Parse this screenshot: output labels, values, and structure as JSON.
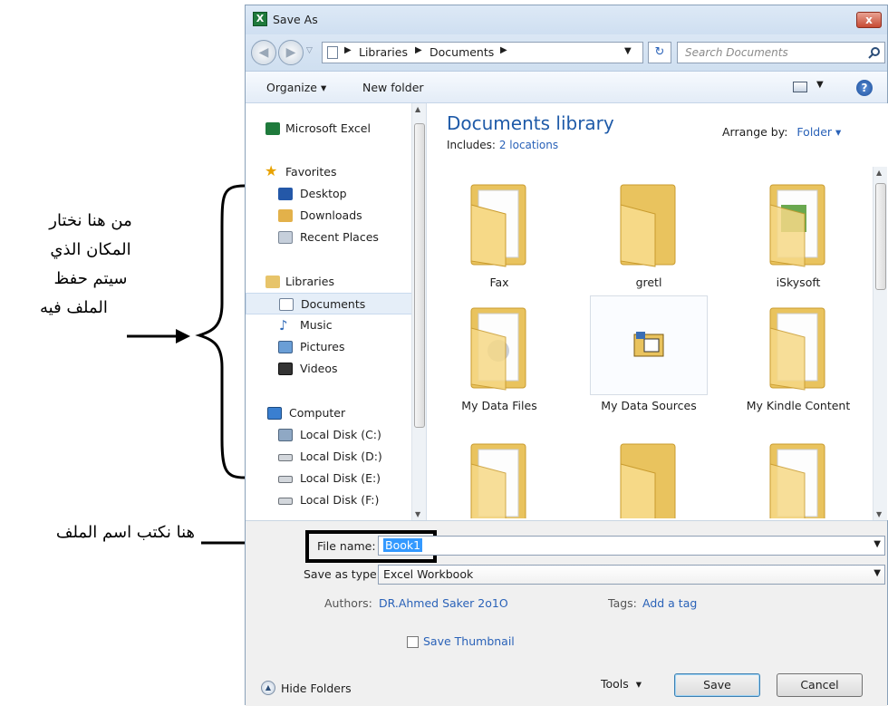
{
  "annotations": {
    "location_lines": [
      "من هنا نختار",
      "المكان الذي",
      "سيتم حفظ",
      "الملف فيه"
    ],
    "filename_note": "هنا نكتب اسم الملف"
  },
  "dialog": {
    "title": "Save As",
    "close_label": "x",
    "breadcrumb": [
      "Libraries",
      "Documents"
    ],
    "search_placeholder": "Search Documents",
    "toolbar": {
      "organize": "Organize",
      "new_folder": "New folder"
    },
    "nav": {
      "app": "Microsoft Excel",
      "favorites": "Favorites",
      "favorites_items": [
        "Desktop",
        "Downloads",
        "Recent Places"
      ],
      "libraries": "Libraries",
      "libraries_items": [
        "Documents",
        "Music",
        "Pictures",
        "Videos"
      ],
      "computer": "Computer",
      "computer_items": [
        "Local Disk (C:)",
        "Local Disk (D:)",
        "Local Disk (E:)",
        "Local Disk (F:)"
      ]
    },
    "library": {
      "title": "Documents library",
      "includes_label": "Includes:",
      "includes_link": "2 locations",
      "arrange_label": "Arrange by:",
      "arrange_value": "Folder"
    },
    "folders": [
      {
        "name": "Fax"
      },
      {
        "name": "gretl"
      },
      {
        "name": "iSkysoft"
      },
      {
        "name": "My Data Files"
      },
      {
        "name": "My Data Sources"
      },
      {
        "name": "My Kindle Content"
      }
    ],
    "form": {
      "filename_label": "File name:",
      "filename_value": "Book1",
      "savetype_label": "Save as type:",
      "savetype_value": "Excel Workbook",
      "authors_label": "Authors:",
      "authors_value": "DR.Ahmed Saker 2o1O",
      "tags_label": "Tags:",
      "tags_value": "Add a tag",
      "thumbnail_label": "Save Thumbnail"
    },
    "footer": {
      "hide_folders": "Hide Folders",
      "tools": "Tools",
      "save": "Save",
      "cancel": "Cancel"
    }
  },
  "colors": {
    "accent": "#2a62b8",
    "folder": "#f3d27a",
    "title_blue": "#1e5aa8"
  }
}
